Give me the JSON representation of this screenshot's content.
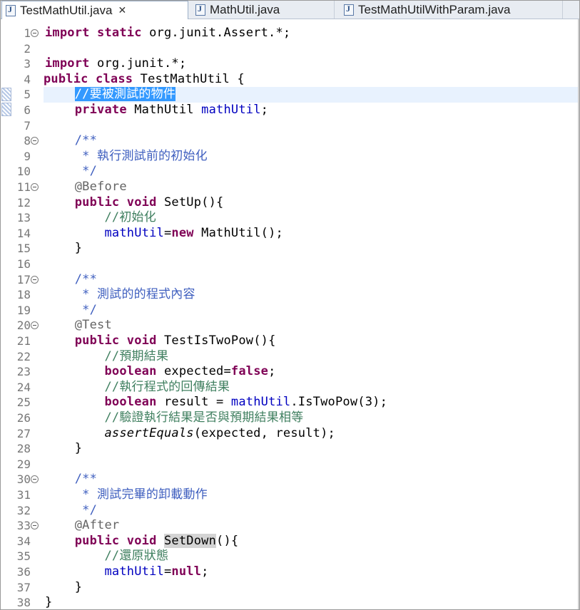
{
  "tabs": [
    {
      "label": "TestMathUtil.java",
      "active": true,
      "icon": "java-file-icon",
      "close": "close-icon"
    },
    {
      "label": "MathUtil.java",
      "active": false,
      "icon": "java-file-icon"
    },
    {
      "label": "TestMathUtilWithParam.java",
      "active": false,
      "icon": "java-file-icon"
    }
  ],
  "line_numbers": [
    "1",
    "2",
    "3",
    "4",
    "5",
    "6",
    "7",
    "8",
    "9",
    "10",
    "11",
    "12",
    "13",
    "14",
    "15",
    "16",
    "17",
    "18",
    "19",
    "20",
    "21",
    "22",
    "23",
    "24",
    "25",
    "26",
    "27",
    "28",
    "29",
    "30",
    "31",
    "32",
    "33",
    "34",
    "35",
    "36",
    "37",
    "38"
  ],
  "folded_lines": [
    "1",
    "8",
    "11",
    "17",
    "20",
    "30",
    "33"
  ],
  "code": {
    "l1": {
      "a": "import",
      "b": " ",
      "c": "static",
      "d": " org.junit.Assert.*;"
    },
    "l3": {
      "a": "import",
      "b": " org.junit.*;"
    },
    "l4": {
      "a": "public",
      "b": " ",
      "c": "class",
      "d": " TestMathUtil {"
    },
    "l5": {
      "a": "    ",
      "b": "//要被測試的物件"
    },
    "l6": {
      "a": "    ",
      "b": "private",
      "c": " MathUtil ",
      "d": "mathUtil",
      "e": ";"
    },
    "l8": {
      "a": "    /**"
    },
    "l9": {
      "a": "     * 執行測試前的初始化"
    },
    "l10": {
      "a": "     */"
    },
    "l11": {
      "a": "    @Before"
    },
    "l12": {
      "a": "    ",
      "b": "public",
      "c": " ",
      "d": "void",
      "e": " SetUp(){"
    },
    "l13": {
      "a": "        //初始化"
    },
    "l14": {
      "a": "        ",
      "b": "mathUtil",
      "c": "=",
      "d": "new",
      "e": " MathUtil();"
    },
    "l15": {
      "a": "    }"
    },
    "l17": {
      "a": "    /**"
    },
    "l18": {
      "a": "     * 測試的的程式內容"
    },
    "l19": {
      "a": "     */"
    },
    "l20": {
      "a": "    @Test"
    },
    "l21": {
      "a": "    ",
      "b": "public",
      "c": " ",
      "d": "void",
      "e": " TestIsTwoPow(){"
    },
    "l22": {
      "a": "        //預期結果"
    },
    "l23": {
      "a": "        ",
      "b": "boolean",
      "c": " expected=",
      "d": "false",
      "e": ";"
    },
    "l24": {
      "a": "        //執行程式的回傳結果"
    },
    "l25": {
      "a": "        ",
      "b": "boolean",
      "c": " result = ",
      "d": "mathUtil",
      "e": ".IsTwoPow(3);"
    },
    "l26": {
      "a": "        //驗證執行結果是否與預期結果相等"
    },
    "l27": {
      "a": "        ",
      "b": "assertEquals",
      "c": "(expected, result);"
    },
    "l28": {
      "a": "    }"
    },
    "l30": {
      "a": "    /**"
    },
    "l31": {
      "a": "     * 測試完畢的卸載動作"
    },
    "l32": {
      "a": "     */"
    },
    "l33": {
      "a": "    @After"
    },
    "l34": {
      "a": "    ",
      "b": "public",
      "c": " ",
      "d": "void",
      "e": " ",
      "f": "SetDown",
      "g": "(){"
    },
    "l35": {
      "a": "        //還原狀態"
    },
    "l36": {
      "a": "        ",
      "b": "mathUtil",
      "c": "=",
      "d": "null",
      "e": ";"
    },
    "l37": {
      "a": "    }"
    },
    "l38": {
      "a": "}"
    }
  },
  "colors": {
    "keyword": "#7f0055",
    "comment": "#3f7f5f",
    "javadoc": "#3f5fbf",
    "annotation": "#646464",
    "field": "#0000c0",
    "selection": "#3399ff",
    "current_line": "#e8f2fe"
  }
}
